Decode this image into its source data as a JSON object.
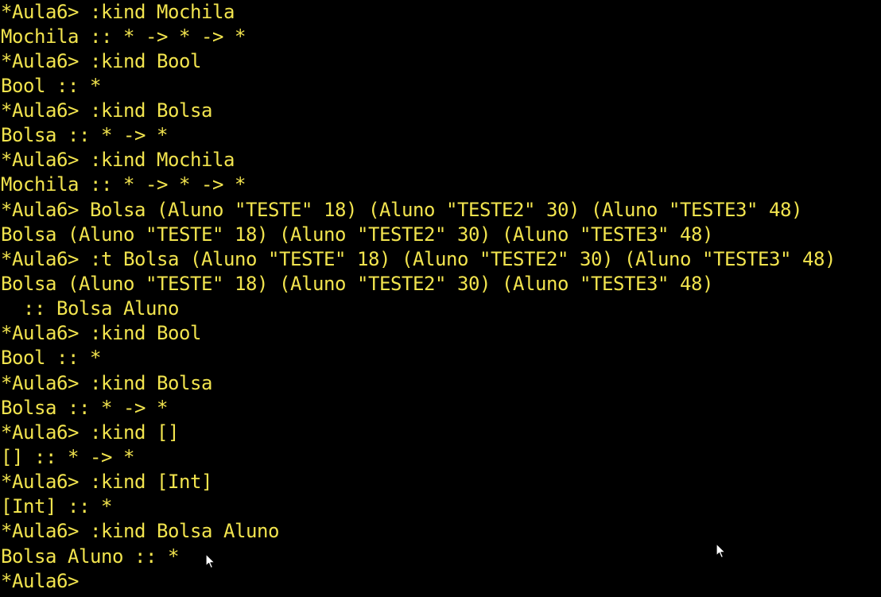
{
  "terminal": {
    "text_color": "#F2E44E",
    "background_color": "#000000",
    "lines": [
      "*Aula6> :kind Mochila",
      "Mochila :: * -> * -> *",
      "*Aula6> :kind Bool",
      "Bool :: *",
      "*Aula6> :kind Bolsa",
      "Bolsa :: * -> *",
      "*Aula6> :kind Mochila",
      "Mochila :: * -> * -> *",
      "*Aula6> Bolsa (Aluno \"TESTE\" 18) (Aluno \"TESTE2\" 30) (Aluno \"TESTE3\" 48)",
      "Bolsa (Aluno \"TESTE\" 18) (Aluno \"TESTE2\" 30) (Aluno \"TESTE3\" 48)",
      "*Aula6> :t Bolsa (Aluno \"TESTE\" 18) (Aluno \"TESTE2\" 30) (Aluno \"TESTE3\" 48)",
      "Bolsa (Aluno \"TESTE\" 18) (Aluno \"TESTE2\" 30) (Aluno \"TESTE3\" 48)",
      "  :: Bolsa Aluno",
      "*Aula6> :kind Bool",
      "Bool :: *",
      "*Aula6> :kind Bolsa",
      "Bolsa :: * -> *",
      "*Aula6> :kind []",
      "[] :: * -> *",
      "*Aula6> :kind [Int]",
      "[Int] :: *",
      "*Aula6> :kind Bolsa Aluno",
      "Bolsa Aluno :: *",
      "*Aula6>"
    ]
  },
  "mouse_cursors": [
    "mouse-pointer-icon",
    "mouse-pointer-icon"
  ]
}
